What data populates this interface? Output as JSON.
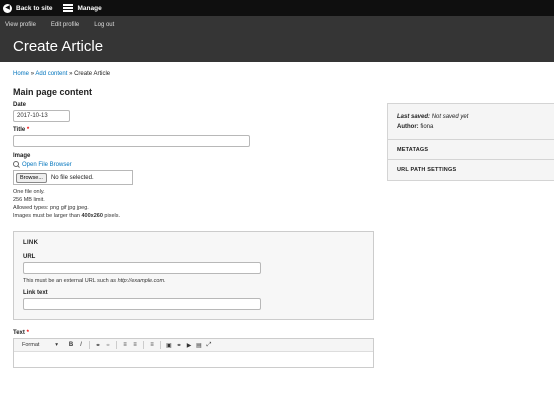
{
  "toolbar": {
    "back_label": "Back to site",
    "manage_label": "Manage"
  },
  "header": {
    "tabs": [
      "View profile",
      "Edit profile",
      "Log out"
    ],
    "title": "Create Article"
  },
  "breadcrumb": {
    "items": [
      "Home",
      "Add content",
      "Create Article"
    ],
    "separator": "»"
  },
  "form": {
    "section_title": "Main page content",
    "date": {
      "label": "Date",
      "value": "2017-10-13"
    },
    "title": {
      "label": "Title",
      "required_mark": "*",
      "value": ""
    },
    "image": {
      "label": "Image",
      "open_browser_label": "Open File Browser",
      "browse_label": "Browse...",
      "no_file_text": "No file selected.",
      "help_1": "One file only.",
      "help_2": "256 MB limit.",
      "help_3": "Allowed types: png gif jpg jpeg.",
      "help_4_prefix": "Images must be larger than ",
      "help_4_size": "400x260",
      "help_4_suffix": " pixels."
    },
    "link": {
      "legend": "LINK",
      "url_label": "URL",
      "url_value": "",
      "url_help_prefix": "This must be an external URL such as ",
      "url_help_example": "http://example.com",
      "url_help_suffix": ".",
      "text_label": "Link text",
      "text_value": ""
    },
    "text": {
      "label": "Text",
      "required_mark": "*",
      "format_label": "Format",
      "buttons": [
        "B",
        "I"
      ]
    }
  },
  "sidebar": {
    "last_saved_label": "Last saved:",
    "last_saved_value": "Not saved yet",
    "author_label": "Author:",
    "author_value": "fiona",
    "sections": [
      "METATAGS",
      "URL PATH SETTINGS"
    ]
  }
}
